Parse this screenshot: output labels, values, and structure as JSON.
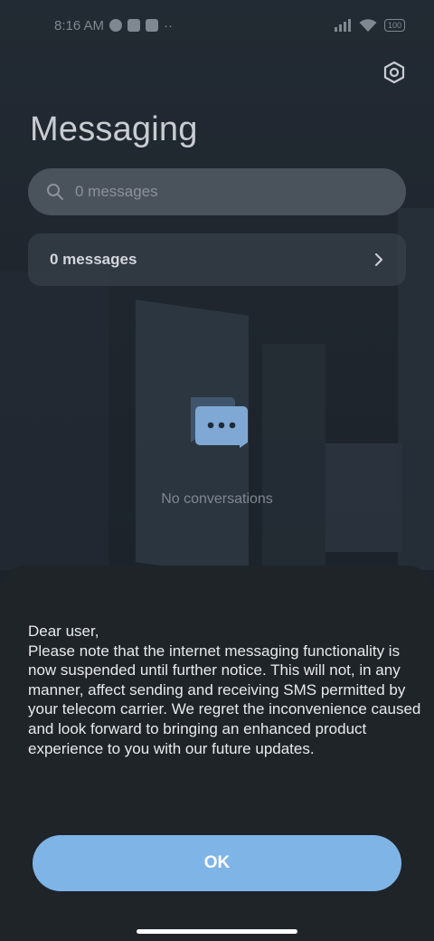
{
  "status_bar": {
    "time": "8:16 AM",
    "battery": "100",
    "icons": [
      "app-icon-1",
      "app-icon-2",
      "app-icon-3",
      "more-dots-icon",
      "signal-icon",
      "wifi-icon",
      "battery-icon"
    ]
  },
  "header": {
    "title": "Messaging",
    "settings_icon": "settings-hexagon-icon"
  },
  "search": {
    "placeholder": "0 messages",
    "icon": "search-icon"
  },
  "messages_row": {
    "label": "0 messages",
    "icon": "chevron-right-icon"
  },
  "empty_state": {
    "icon": "chat-bubbles-icon",
    "text": "No conversations"
  },
  "dialog": {
    "lines": [
      "Dear user,",
      "Please note that the internet messaging functionality is now suspended until further notice. This will not, in any manner, affect sending and receiving SMS permitted by your telecom carrier. We regret the inconvenience caused and look forward to bringing an enhanced product experience to you with our future updates."
    ],
    "ok_label": "OK"
  },
  "colors": {
    "accent": "#7fb4e6",
    "sheet_bg": "#1f2429"
  }
}
